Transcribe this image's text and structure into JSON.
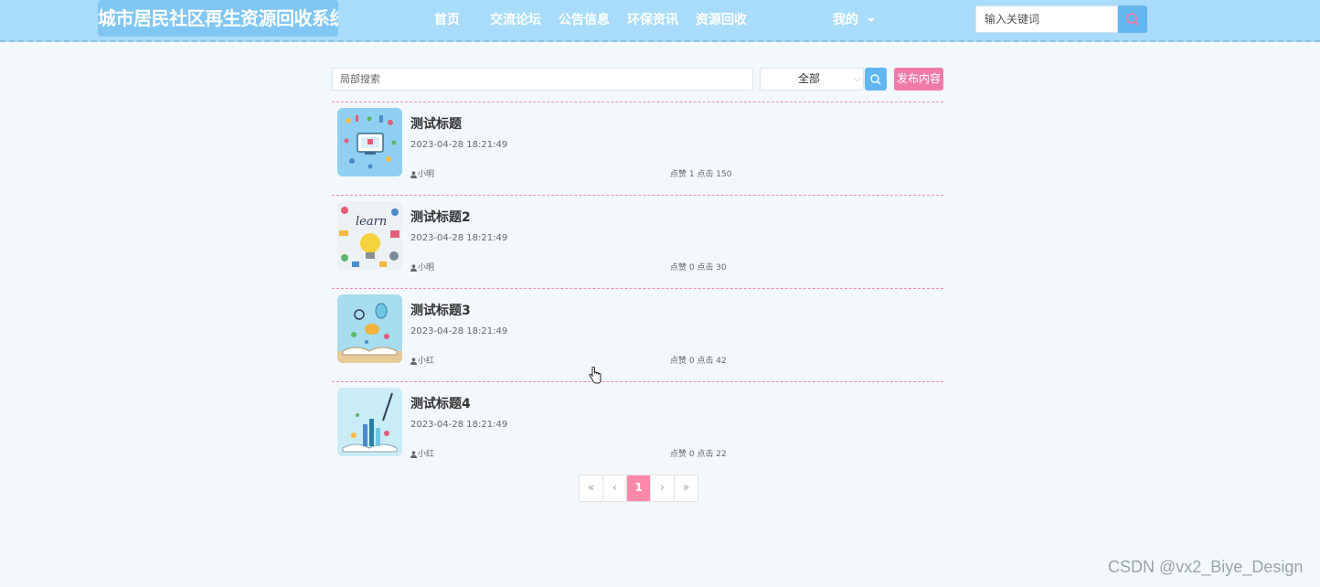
{
  "header": {
    "site_title": "城市居民社区再生资源回收系统",
    "nav": [
      {
        "label": "首页"
      },
      {
        "label": "交流论坛"
      },
      {
        "label": "公告信息"
      },
      {
        "label": "环保资讯"
      },
      {
        "label": "资源回收"
      }
    ],
    "user_menu_label": "我的",
    "search_placeholder": "输入关键词",
    "accent_color": "#a9dcfb"
  },
  "filters": {
    "search_placeholder": "局部搜索",
    "category_selected": "全部",
    "publish_label": "发布内容"
  },
  "posts": [
    {
      "title": "测试标题",
      "date": "2023-04-28 18:21:49",
      "author": "小明",
      "stats": "点赞 1 点击 150"
    },
    {
      "title": "测试标题2",
      "date": "2023-04-28 18:21:49",
      "author": "小明",
      "stats": "点赞 0 点击 30"
    },
    {
      "title": "测试标题3",
      "date": "2023-04-28 18:21:49",
      "author": "小红",
      "stats": "点赞 0 点击 42"
    },
    {
      "title": "测试标题4",
      "date": "2023-04-28 18:21:49",
      "author": "小红",
      "stats": "点赞 0 点击 22"
    }
  ],
  "pagination": {
    "first": "«",
    "prev": "‹",
    "current": "1",
    "next": "›",
    "last": "»"
  },
  "watermark": "CSDN @vx2_Biye_Design"
}
